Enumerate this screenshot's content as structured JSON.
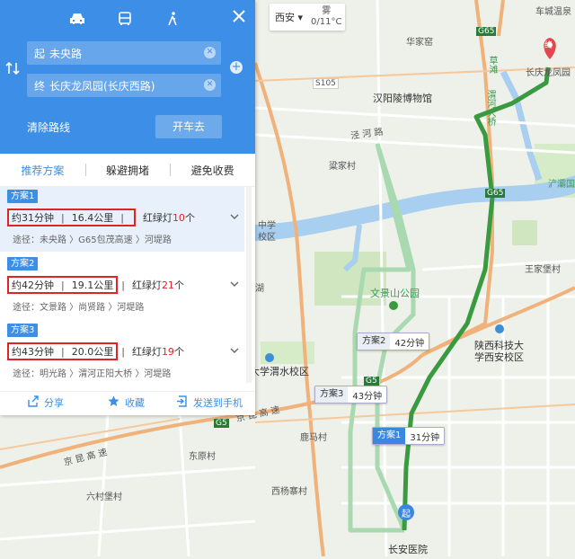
{
  "header": {
    "modes": [
      "car-icon",
      "bus-icon",
      "walk-icon"
    ],
    "start_prefix": "起",
    "start_value": "未央路",
    "end_prefix": "终",
    "end_value": "长庆龙凤园(长庆西路)",
    "clear_route": "清除路线",
    "drive_button": "开车去"
  },
  "tabs": [
    "推荐方案",
    "躲避拥堵",
    "避免收费"
  ],
  "plans": [
    {
      "badge": "方案1",
      "time": "约31分钟",
      "distance": "16.4公里",
      "lights_label": "红绿灯",
      "lights_count": "10",
      "lights_unit": "个",
      "route": "途径：未央路 〉G65包茂高速 〉河堤路"
    },
    {
      "badge": "方案2",
      "time": "约42分钟",
      "distance": "19.1公里",
      "lights_label": "红绿灯",
      "lights_count": "21",
      "lights_unit": "个",
      "route": "途径：文景路 〉尚贤路 〉河堤路"
    },
    {
      "badge": "方案3",
      "time": "约43分钟",
      "distance": "20.0公里",
      "lights_label": "红绿灯",
      "lights_count": "19",
      "lights_unit": "个",
      "route": "途径：明光路 〉渭河正阳大桥 〉河堤路"
    }
  ],
  "footer": {
    "share": "分享",
    "favorite": "收藏",
    "send": "发送到手机"
  },
  "weather": {
    "city": "西安",
    "condition": "雾",
    "temp": "0/11°C"
  },
  "map_labels": {
    "village_top": "车城温泉",
    "hujiazhuang": "华家窑",
    "museum": "汉阳陵博物馆",
    "s105": "S105",
    "g65_top": "G65",
    "longfengyuan": "长庆龙凤园",
    "caotan": "草滩",
    "weihe": "渭河大桥",
    "xiajiazhuang": "粱家村",
    "road_jingchuan": "泾 河 路",
    "g65v": "G65",
    "chanba": "浐灞国",
    "school_mid": "中学",
    "school_mid2": "校区",
    "wenjingshan": "文景山公园",
    "wangjiabao": "王家堡村",
    "hu": "湖",
    "shaanxi_tech": "陕西科技大",
    "shaanxi_tech2": "学西安校区",
    "weishui": "大学渭水校区",
    "g5": "G5",
    "jingkun": "京 昆 高 速",
    "jingkun2": "京 昆 高 速",
    "dongyuan": "东原村",
    "liuwei": "六村堡村",
    "luoma": "鹿马村",
    "xibei": "西杨寨村",
    "changan": "长安医院",
    "lucun": "宏府",
    "route1_name": "方案1",
    "route1_time": "31分钟",
    "route2_name": "方案2",
    "route2_time": "42分钟",
    "route3_name": "方案3",
    "route3_time": "43分钟",
    "start_marker": "起",
    "end_marker": "终",
    "g5_mid": "G5"
  },
  "colors": {
    "accent": "#3d8ee6",
    "route_main": "#3a9a3f",
    "route_alt": "#a9d9b0",
    "highlight_box": "#e02424"
  }
}
